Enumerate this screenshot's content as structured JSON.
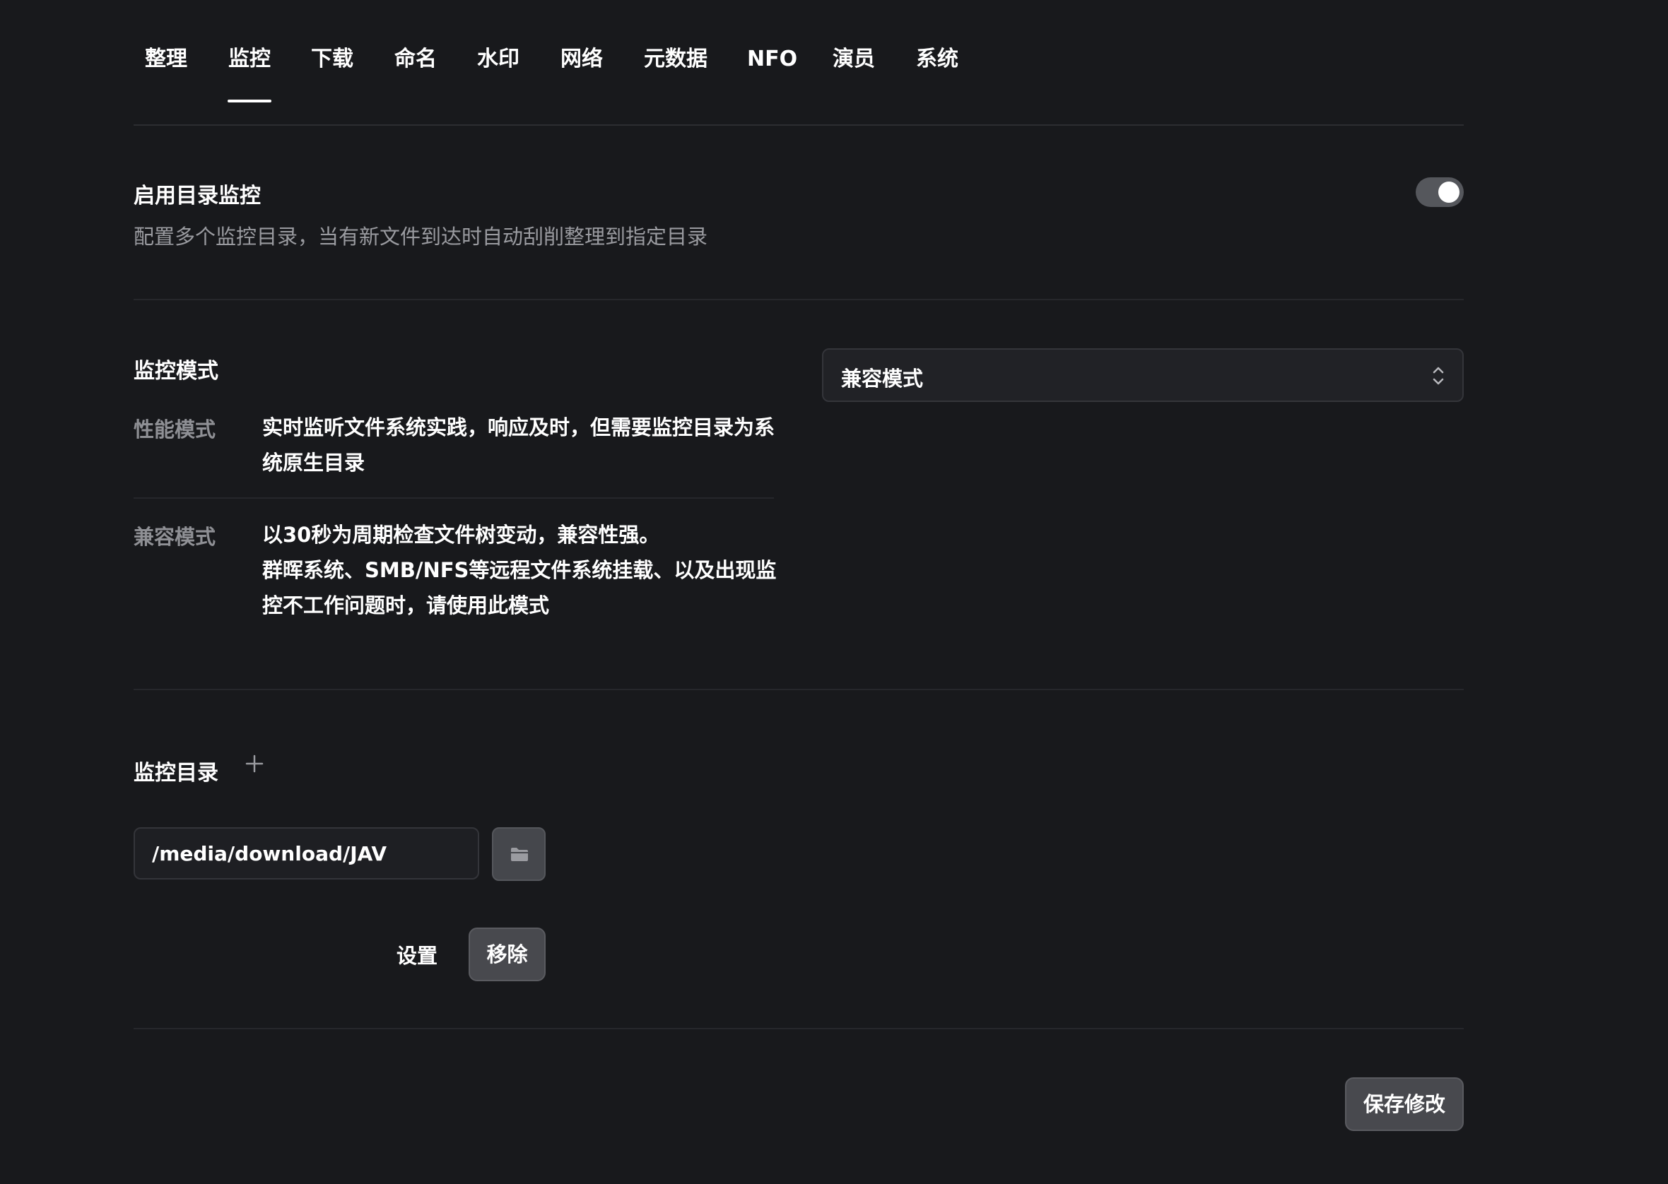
{
  "tabs": [
    {
      "label": "整理"
    },
    {
      "label": "监控",
      "active": true
    },
    {
      "label": "下载"
    },
    {
      "label": "命名"
    },
    {
      "label": "水印"
    },
    {
      "label": "网络"
    },
    {
      "label": "元数据"
    },
    {
      "label": "NFO"
    },
    {
      "label": "演员"
    },
    {
      "label": "系统"
    }
  ],
  "monitor": {
    "title": "启用目录监控",
    "description": "配置多个监控目录，当有新文件到达时自动刮削整理到指定目录",
    "enabled": true
  },
  "mode": {
    "title": "监控模式",
    "selected": "兼容模式",
    "options": [
      {
        "name": "性能模式",
        "desc": "实时监听文件系统实践，响应及时，但需要监控目录为系统原生目录"
      },
      {
        "name": "兼容模式",
        "desc_line1": "以30秒为周期检查文件树变动，兼容性强。",
        "desc_pre": "群晖系统、SMB/NFS等远程文件系统挂载、以及出现",
        "desc_bold": "监控不工作",
        "desc_post": "问题时，请使用此模式"
      }
    ]
  },
  "directories": {
    "title": "监控目录",
    "add_icon": "plus-icon",
    "items": [
      {
        "path": "/media/download/JAV",
        "browse_icon": "folder-icon",
        "settings_label": "设置",
        "remove_label": "移除"
      }
    ]
  },
  "footer": {
    "save_label": "保存修改"
  }
}
